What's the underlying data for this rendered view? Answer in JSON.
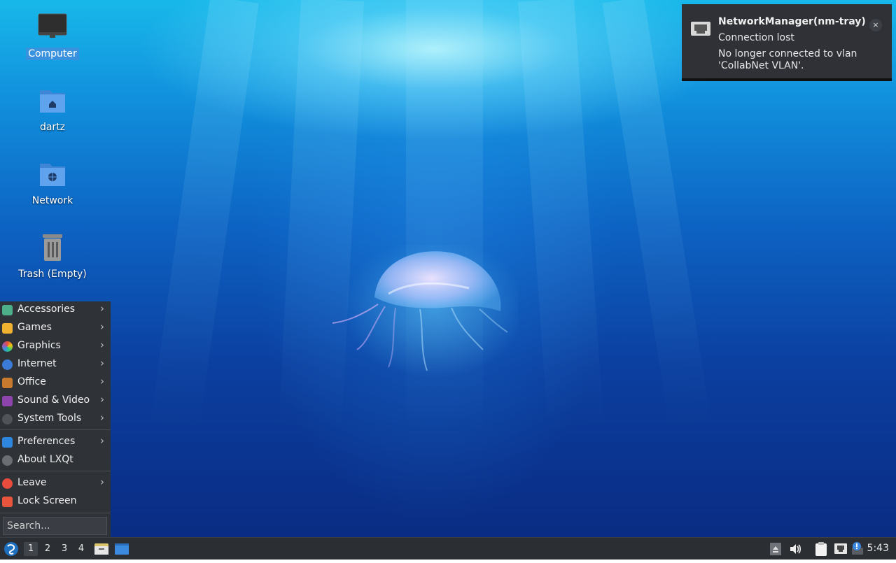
{
  "desktop": {
    "icons": [
      {
        "label": "Computer",
        "icon": "computer-icon",
        "selected": true
      },
      {
        "label": "dartz",
        "icon": "home-folder-icon"
      },
      {
        "label": "Network",
        "icon": "network-folder-icon"
      },
      {
        "label": "Trash (Empty)",
        "icon": "trash-icon"
      }
    ]
  },
  "notification": {
    "title": "NetworkManager(nm-tray)",
    "subtitle": "Connection lost",
    "body": "No longer connected to vlan 'CollabNet VLAN'.",
    "close_glyph": "×",
    "icon": "network-wired-icon"
  },
  "menu": {
    "items": [
      {
        "label": "Accessories",
        "icon": "accessories-icon",
        "submenu": true
      },
      {
        "label": "Games",
        "icon": "games-icon",
        "submenu": true
      },
      {
        "label": "Graphics",
        "icon": "graphics-icon",
        "submenu": true
      },
      {
        "label": "Internet",
        "icon": "internet-icon",
        "submenu": true
      },
      {
        "label": "Office",
        "icon": "office-icon",
        "submenu": true
      },
      {
        "label": "Sound & Video",
        "icon": "sound-video-icon",
        "submenu": true
      },
      {
        "label": "System Tools",
        "icon": "system-tools-icon",
        "submenu": true
      },
      {
        "label": "Preferences",
        "icon": "preferences-icon",
        "submenu": true
      },
      {
        "label": "About LXQt",
        "icon": "about-icon",
        "submenu": false
      },
      {
        "label": "Leave",
        "icon": "leave-icon",
        "submenu": true
      },
      {
        "label": "Lock Screen",
        "icon": "lock-icon",
        "submenu": false
      }
    ],
    "arrow_glyph": "›",
    "search_placeholder": "Search..."
  },
  "taskbar": {
    "workspaces": [
      "1",
      "2",
      "3",
      "4"
    ],
    "active_workspace": "1",
    "clock": "5:43"
  },
  "colors": {
    "menu_bg": "#2f3237",
    "taskbar_bg": "#2b2e33",
    "notification_bg": "#2f3136",
    "selection": "#468cdc"
  }
}
